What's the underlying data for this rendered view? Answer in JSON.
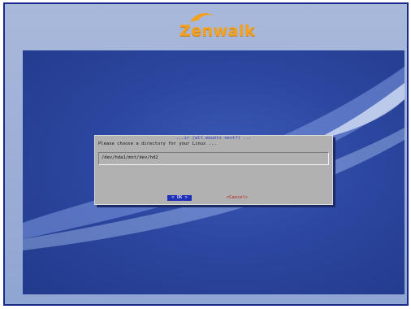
{
  "installer": {
    "brand": "Zenwalk"
  },
  "dialog": {
    "title": "...ir (all mounts next?) ...",
    "message": "Please choose a directory for your Linux ...",
    "input_value": "/dev/hda1/mnt/dev/hd2",
    "ok_label": "< OK >",
    "cancel_label": "<Cancel>"
  },
  "colors": {
    "desktop_blue": "#2c47a0",
    "dialog_gray": "#b1b1b1",
    "ok_highlight": "#1f2fb8",
    "logo_orange": "#f3a21f"
  }
}
